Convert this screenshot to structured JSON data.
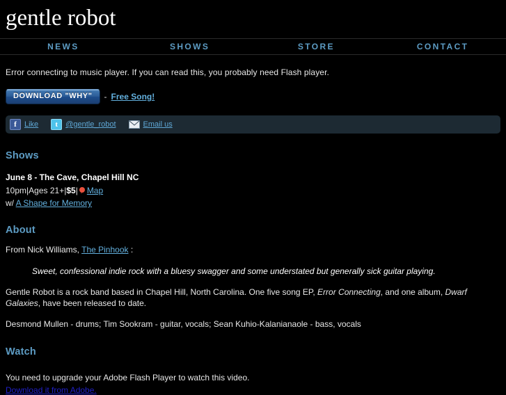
{
  "site": {
    "logo": "gentle robot"
  },
  "nav": {
    "items": [
      {
        "label": "NEWS",
        "name": "nav-news"
      },
      {
        "label": "SHOWS",
        "name": "nav-shows"
      },
      {
        "label": "STORE",
        "name": "nav-store"
      },
      {
        "label": "CONTACT",
        "name": "nav-contact"
      }
    ]
  },
  "player": {
    "error": "Error connecting to music player. If you can read this, you probably need Flash player.",
    "download_button": "DOWNLOAD \"WHY\"",
    "separator": "-",
    "free_song_link": "Free Song!"
  },
  "social": {
    "facebook": {
      "icon": "facebook-icon",
      "glyph": "f",
      "label": "Like"
    },
    "twitter": {
      "icon": "twitter-icon",
      "glyph": "t",
      "label": "@gentle_robot"
    },
    "email": {
      "icon": "envelope-icon",
      "label": "Email us"
    }
  },
  "shows": {
    "heading": "Shows",
    "event": {
      "title": "June 8 - The Cave, Chapel Hill NC",
      "time": "10pm",
      "sep1": " | ",
      "ages": "Ages 21+",
      "sep2": " | ",
      "price": "$5",
      "sep3": " | ",
      "map_icon": "map-pin-icon",
      "map_label": "Map",
      "with_prefix": "w/ ",
      "support_act": "A Shape for Memory"
    }
  },
  "about": {
    "heading": "About",
    "source_prefix": "From Nick Williams, ",
    "source_link": "The Pinhook",
    "source_suffix": " :",
    "quote": "Sweet, confessional indie rock with a bluesy swagger and some understated but generally sick guitar playing.",
    "bio_part1": "Gentle Robot is a rock band based in Chapel Hill, North Carolina. One five song EP, ",
    "bio_em1": "Error Connecting",
    "bio_part2": ", and one album, ",
    "bio_em2": "Dwarf Galaxies",
    "bio_part3": ", have been released to date.",
    "members": "Desmond Mullen - drums; Tim Sookram - guitar, vocals; Sean Kuhio-Kalanianaole - bass, vocals"
  },
  "watch": {
    "heading": "Watch",
    "flash_note": "You need to upgrade your Adobe Flash Player to watch this video.",
    "adobe_link": "Download it from Adobe."
  },
  "colors": {
    "background": "#000000",
    "accent_blue": "#5d9cc4",
    "link_blue": "#63b0de",
    "social_bar": "#1d2a33",
    "button_blue": "#2c5c97",
    "pin_red": "#e8503c",
    "adobe_link_blue": "#2020c8"
  }
}
